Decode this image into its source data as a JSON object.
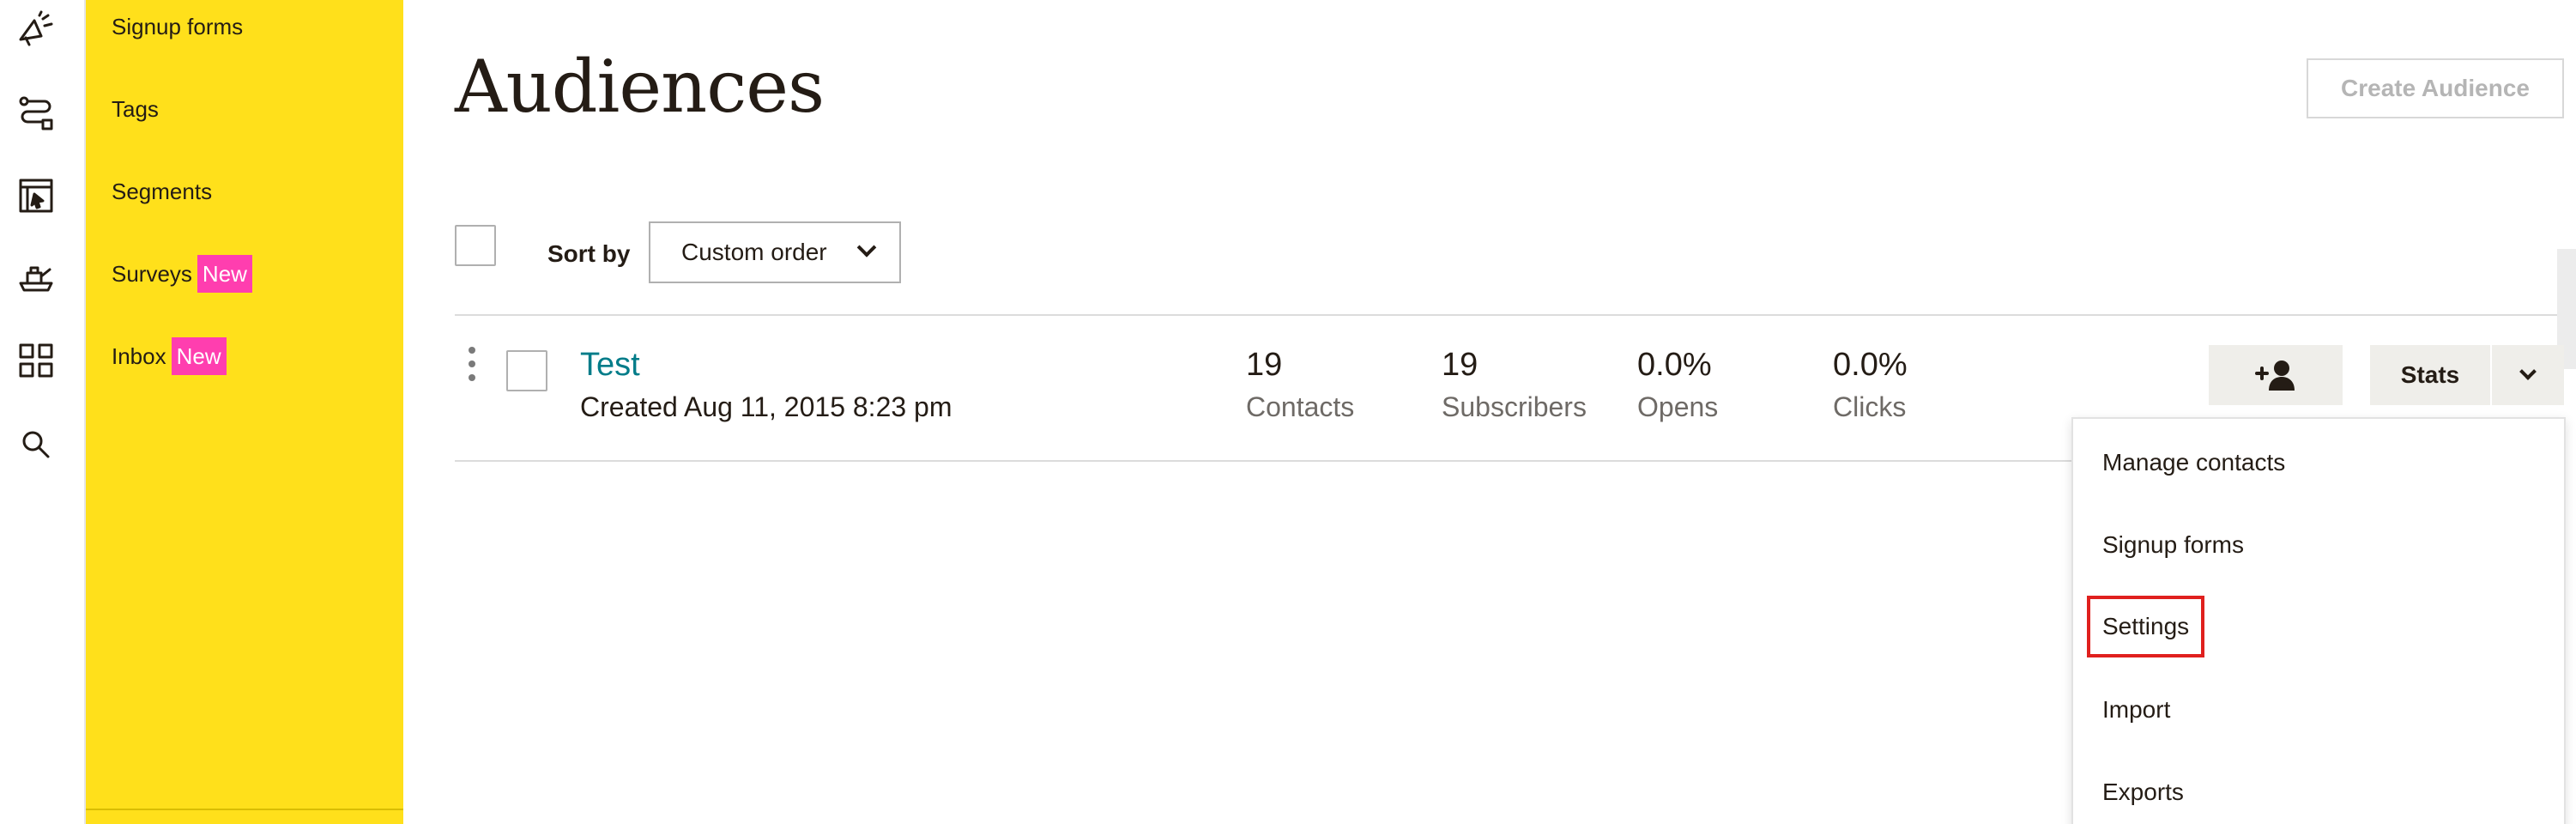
{
  "rail": {
    "icons": [
      "megaphone-icon",
      "automations-icon",
      "website-icon",
      "integrations-icon",
      "grid-icon",
      "search-icon"
    ]
  },
  "subnav": {
    "items": [
      {
        "label": "Signup forms"
      },
      {
        "label": "Tags"
      },
      {
        "label": "Segments"
      },
      {
        "label": "Surveys",
        "badge": "New"
      },
      {
        "label": "Inbox",
        "badge": "New"
      }
    ]
  },
  "header": {
    "title": "Audiences",
    "create_label": "Create Audience"
  },
  "toolbar": {
    "sort_label": "Sort by",
    "sort_value": "Custom order"
  },
  "audience": {
    "name": "Test",
    "created": "Created Aug 11, 2015 8:23 pm",
    "stats": [
      {
        "value": "19",
        "label": "Contacts"
      },
      {
        "value": "19",
        "label": "Subscribers"
      },
      {
        "value": "0.0%",
        "label": "Opens"
      },
      {
        "value": "0.0%",
        "label": "Clicks"
      }
    ],
    "stats_button": "Stats"
  },
  "dropdown": {
    "items": [
      {
        "label": "Manage contacts"
      },
      {
        "label": "Signup forms"
      },
      {
        "label": "Settings"
      },
      {
        "label": "Import"
      },
      {
        "label": "Exports"
      }
    ]
  },
  "colors": {
    "subnav_bg": "#ffe01b",
    "badge_bg": "#ff3eaf",
    "link": "#007c89",
    "highlight": "#e0201e"
  }
}
